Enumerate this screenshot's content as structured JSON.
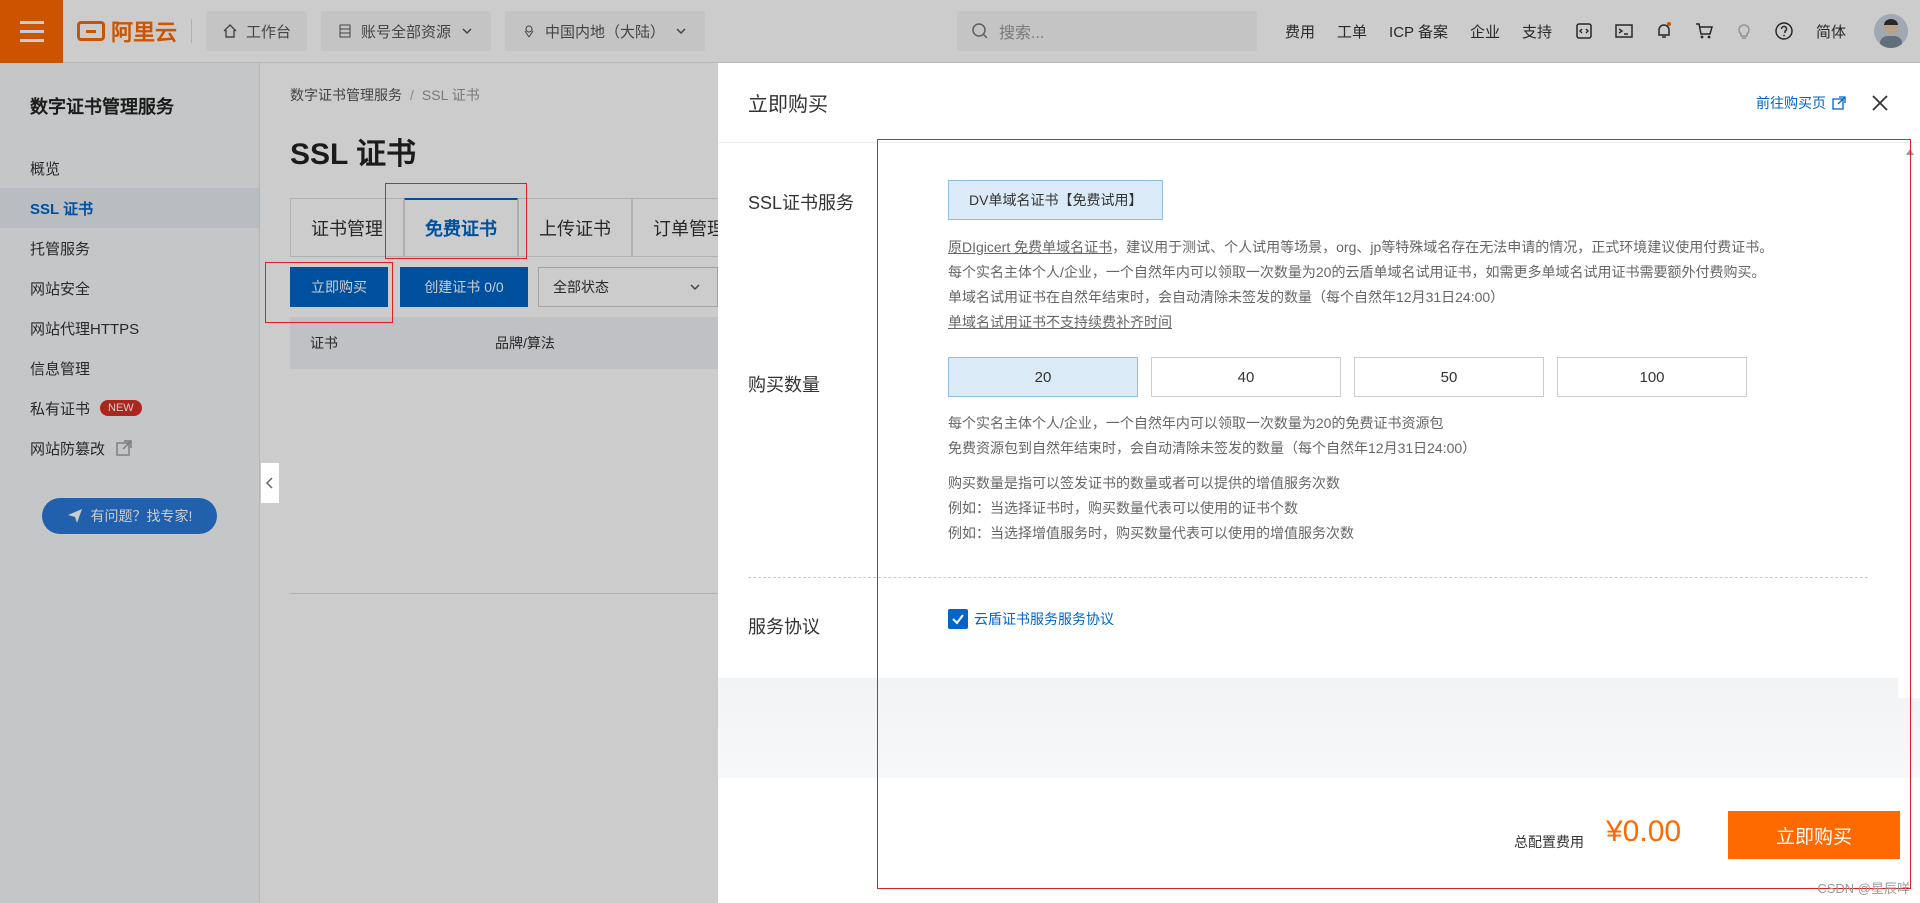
{
  "topbar": {
    "logo_text": "阿里云",
    "workbench": "工作台",
    "resources": "账号全部资源",
    "region": "中国内地（大陆）",
    "search_placeholder": "搜索...",
    "links": [
      "费用",
      "工单",
      "ICP 备案",
      "企业",
      "支持"
    ],
    "lang": "简体",
    "accent": "#ff6a00"
  },
  "sidebar": {
    "title": "数字证书管理服务",
    "items": [
      {
        "label": "概览"
      },
      {
        "label": "SSL 证书"
      },
      {
        "label": "托管服务"
      },
      {
        "label": "网站安全"
      },
      {
        "label": "网站代理HTTPS"
      },
      {
        "label": "信息管理"
      },
      {
        "label": "私有证书",
        "badge": "NEW"
      },
      {
        "label": "网站防篡改"
      }
    ],
    "expert_button": "有问题？找专家!"
  },
  "main": {
    "breadcrumb": [
      "数字证书管理服务",
      "SSL 证书"
    ],
    "title": "SSL 证书",
    "tabs": [
      "证书管理",
      "免费证书",
      "上传证书",
      "订单管理"
    ],
    "buy_button": "立即购买",
    "create_button": "创建证书 0/0",
    "status_select": "全部状态",
    "table_headers": [
      "证书",
      "品牌/算法"
    ]
  },
  "drawer": {
    "title": "立即购买",
    "link": "前往购买页",
    "ssl_label": "SSL证书服务",
    "ssl_option": "DV单域名证书【免费试用】",
    "ssl_desc_link": "原DIgicert 免费单域名证书",
    "ssl_desc_1": "，建议用于测试、个人试用等场景，org、jp等特殊域名存在无法申请的情况，正式环境建议使用付费证书。",
    "ssl_desc_2": "每个实名主体个人/企业，一个自然年内可以领取一次数量为20的云盾单域名试用证书，如需更多单域名试用证书需要额外付费购买。",
    "ssl_desc_3": "单域名试用证书在自然年结束时，会自动清除未签发的数量（每个自然年12月31日24:00）",
    "ssl_desc_4": "单域名试用证书不支持续费补齐时间",
    "qty_label": "购买数量",
    "qty_options": [
      "20",
      "40",
      "50",
      "100"
    ],
    "qty_selected": "20",
    "qty_desc_1": "每个实名主体个人/企业，一个自然年内可以领取一次数量为20的免费证书资源包",
    "qty_desc_2": "免费资源包到自然年结束时，会自动清除未签发的数量（每个自然年12月31日24:00）",
    "qty_desc_3": "购买数量是指可以签发证书的数量或者可以提供的增值服务次数",
    "qty_desc_4": "例如：当选择证书时，购买数量代表可以使用的证书个数",
    "qty_desc_5": "例如：当选择增值服务时，购买数量代表可以使用的增值服务次数",
    "agreement_label": "服务协议",
    "agreement_link": "云盾证书服务服务协议",
    "agreement_checked": true,
    "total_label": "总配置费用",
    "total_value": "¥0.00",
    "buy_now": "立即购买"
  },
  "watermark": "CSDN @星辰咩"
}
